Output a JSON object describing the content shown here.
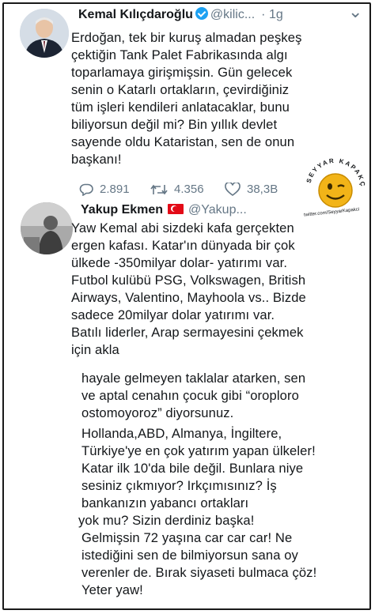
{
  "tweet1": {
    "name": "Kemal Kılıçdaroğlu",
    "handle": "@kilic...",
    "time": "· 1g",
    "lines": [
      "Erdoğan, tek bir kuruş almadan peşkeş",
      "çektiğin Tank Palet Fabrikasında algı",
      "toparlamaya girişmişsin. Gün gelecek",
      "senin o Katarlı ortakların, çevirdiğiniz",
      "tüm işleri kendileri anlatacaklar, bunu",
      "biliyorsun değil mi? Bin yıllık devlet",
      "sayende oldu Kataristan, sen de onun",
      "başkanı!"
    ],
    "replies": "2.891",
    "retweets": "4.356",
    "likes": "38,3B"
  },
  "tweet2": {
    "name": "Yakup Ekmen",
    "handle": "@Yakup...",
    "lines": [
      "Yaw Kemal abi sizdeki kafa gerçekten",
      "ergen kafası. Katar'ın dünyada bir çok",
      "ülkede -350milyar dolar- yatırımı var.",
      "Futbol kulübü PSG, Volkswagen, British",
      "Airways, Valentino, Mayhoola vs.. Bizde",
      "sadece 20milyar dolar yatırımı var.",
      "Batılı liderler, Arap sermayesini çekmek",
      "için akla",
      "hayale gelmeyen taklalar atarken, sen",
      "ve aptal cenahın çocuk gibi “oroploro",
      "ostomoyoroz” diyorsunuz.",
      "Hollanda,ABD, Almanya, İngiltere,",
      "Türkiye'ye en çok yatırım yapan ülkeler!",
      "Katar ilk 10'da bile değil. Bunlara niye",
      "sesiniz çıkmıyor? Irkçımısınız? İş",
      "bankanızın yabancı ortakları",
      "yok mu? Sizin derdiniz başka!",
      "Gelmişsin 72 yaşına car car car! Ne",
      "istediğini sen de bilmiyorsun sana oy",
      "verenler de. Bırak siyaseti bulmaca çöz!",
      "Yeter yaw!"
    ]
  },
  "watermark": {
    "top_text": "SEYYAR KAPAKÇI",
    "bottom_text": "twitter.com/SeyyarKapakci"
  },
  "colors": {
    "text": "#14171a",
    "muted": "#657786",
    "verified": "#1da1f2",
    "flag": "#e30a17",
    "smiley": "#f2b418"
  }
}
